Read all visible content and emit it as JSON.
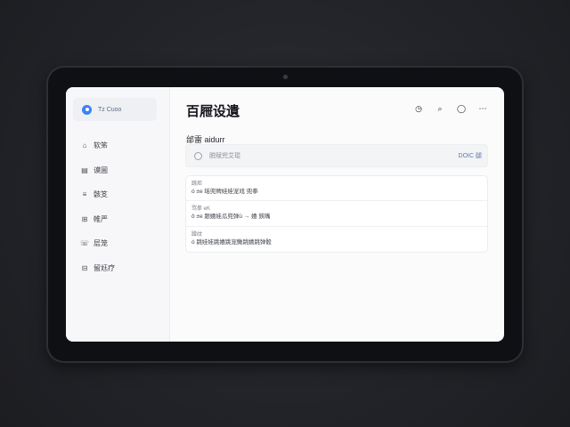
{
  "brand": {
    "name": "Tz Cuoo",
    "logo_icon": "brand-logo-icon"
  },
  "page": {
    "title": "百屜设遺"
  },
  "sidebar": {
    "items": [
      {
        "icon": "user-icon",
        "glyph": "⌂",
        "label": "软笫"
      },
      {
        "icon": "box-icon",
        "glyph": "▤",
        "label": "谟圌"
      },
      {
        "icon": "list-icon",
        "glyph": "≡",
        "label": "骸笅"
      },
      {
        "icon": "grid-icon",
        "glyph": "⊞",
        "label": "帷严"
      },
      {
        "icon": "phone-icon",
        "glyph": "☏",
        "label": "层笼"
      },
      {
        "icon": "lock-icon",
        "glyph": "⊟",
        "label": "留尪疗"
      }
    ]
  },
  "toolbar": {
    "icons": [
      {
        "name": "clock-icon",
        "glyph": "◷"
      },
      {
        "name": "search-icon",
        "glyph": "⌕"
      },
      {
        "name": "chat-icon",
        "glyph": "◯"
      },
      {
        "name": "more-icon",
        "glyph": "⋯"
      }
    ]
  },
  "section": {
    "label": "邰雷 aidurr"
  },
  "search": {
    "text": "脱赋兜艾琨",
    "action": "DOIC 腿"
  },
  "rows": [
    {
      "title": "跳炬",
      "value": "ó ±e 瑶兜稗娃娃宠戏 兜拳"
    },
    {
      "title": "骂拳 eK",
      "value": "ô ±e 跟嬉娃瓜兜弹ü → 嬉 鋏嘴"
    },
    {
      "title": "蹭纹",
      "value": "ó 跳娃娃跳嬉跳宠鳅跳嬉跳弹骰"
    }
  ],
  "colors": {
    "accent": "#3b82f6",
    "page_background": "#24252a",
    "screen_background": "#fbfbfc"
  }
}
